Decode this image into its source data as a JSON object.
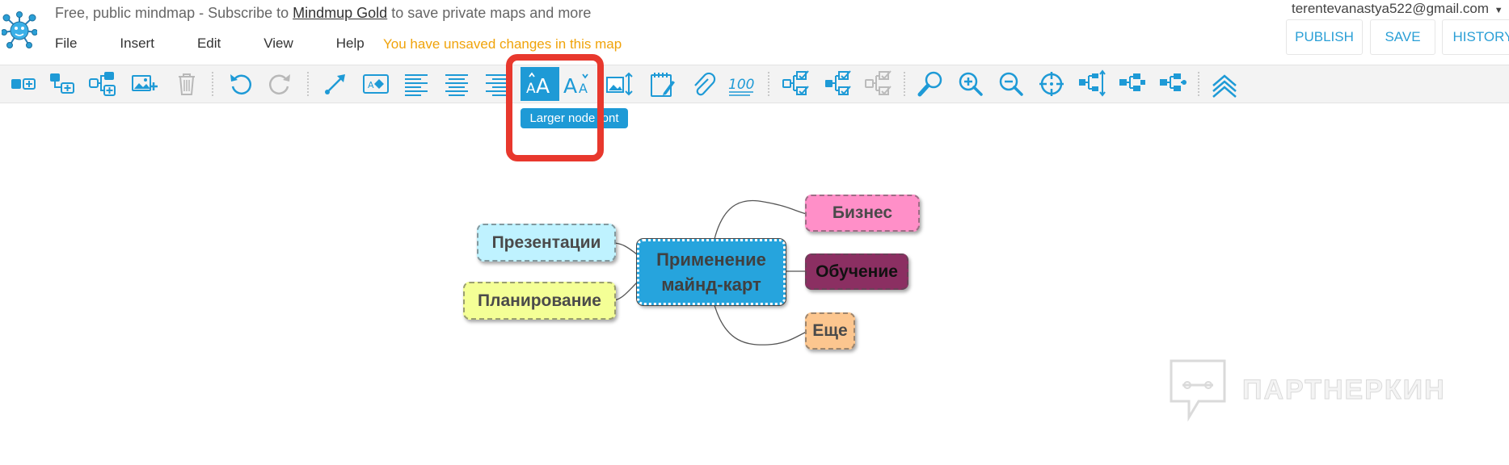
{
  "header": {
    "promo_prefix": "Free, public mindmap - Subscribe to ",
    "promo_link": "Mindmup Gold",
    "promo_suffix": " to save private maps and more",
    "unsaved_notice": "You have unsaved changes in this map",
    "user_email": "terentevanastya522@gmail.com",
    "user_dropdown_glyph": "▼"
  },
  "menu": {
    "file": "File",
    "insert": "Insert",
    "edit": "Edit",
    "view": "View",
    "help": "Help"
  },
  "actions": {
    "publish": "PUBLISH",
    "save": "SAVE",
    "history": "HISTORY"
  },
  "toolbar": {
    "tooltip": "Larger node font",
    "active_tool": "larger-font",
    "tools": [
      "add-node",
      "add-child",
      "add-sibling",
      "add-image",
      "delete",
      "undo",
      "redo",
      "connect",
      "text-style",
      "align-left",
      "align-center",
      "align-right",
      "larger-font",
      "smaller-font",
      "node-size",
      "notes",
      "attachment",
      "measure",
      "select-all",
      "select-children",
      "deselect",
      "search",
      "zoom-in",
      "zoom-out",
      "center",
      "expand",
      "collapse",
      "collapse-children",
      "toggle-toolbar"
    ]
  },
  "mindmap": {
    "root": "Применение майнд-карт",
    "right": [
      "Бизнес",
      "Обучение",
      "Еще"
    ],
    "left": [
      "Презентации",
      "Планирование"
    ]
  },
  "colors": {
    "accent": "#1e9ad6",
    "highlight": "#e8382d",
    "unsaved": "#f0a30a",
    "root": "#26a4dd",
    "business": "#ff8fc8",
    "education": "#8b2f62",
    "more": "#fcc68f",
    "presentations": "#bff2ff",
    "planning": "#f4ff96"
  },
  "watermark": "ПАРТНЕРКИН"
}
